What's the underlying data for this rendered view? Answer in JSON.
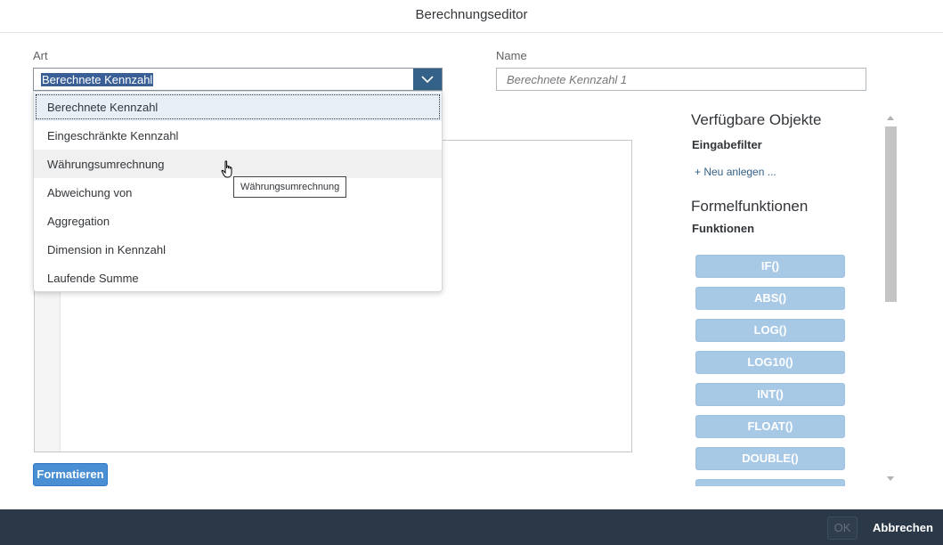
{
  "dialog": {
    "title": "Berechnungseditor"
  },
  "form": {
    "art_label": "Art",
    "art_value": "Berechnete Kennzahl",
    "name_label": "Name",
    "name_placeholder": "Berechnete Kennzahl 1"
  },
  "dropdown": {
    "items": [
      {
        "label": "Berechnete Kennzahl",
        "state": "selected"
      },
      {
        "label": "Eingeschränkte Kennzahl",
        "state": ""
      },
      {
        "label": "Währungsumrechnung",
        "state": "hover"
      },
      {
        "label": "Abweichung von",
        "state": ""
      },
      {
        "label": "Aggregation",
        "state": ""
      },
      {
        "label": "Dimension in Kennzahl",
        "state": ""
      },
      {
        "label": "Laufende Summe",
        "state": ""
      }
    ],
    "tooltip": "Währungsumrechnung"
  },
  "editor": {
    "format_button": "Formatieren"
  },
  "side": {
    "objects_heading": "Verfügbare Objekte",
    "input_filter_label": "Eingabefilter",
    "new_link": "+ Neu anlegen ...",
    "functions_heading": "Formelfunktionen",
    "functions_label": "Funktionen",
    "functions": [
      "IF()",
      "ABS()",
      "LOG()",
      "LOG10()",
      "INT()",
      "FLOAT()",
      "DOUBLE()"
    ]
  },
  "footer": {
    "ok_label": "OK",
    "cancel_label": "Abbrechen"
  },
  "colors": {
    "accent": "#346187",
    "footer_bg": "#2a3848",
    "function_button": "#a8c9e6"
  }
}
